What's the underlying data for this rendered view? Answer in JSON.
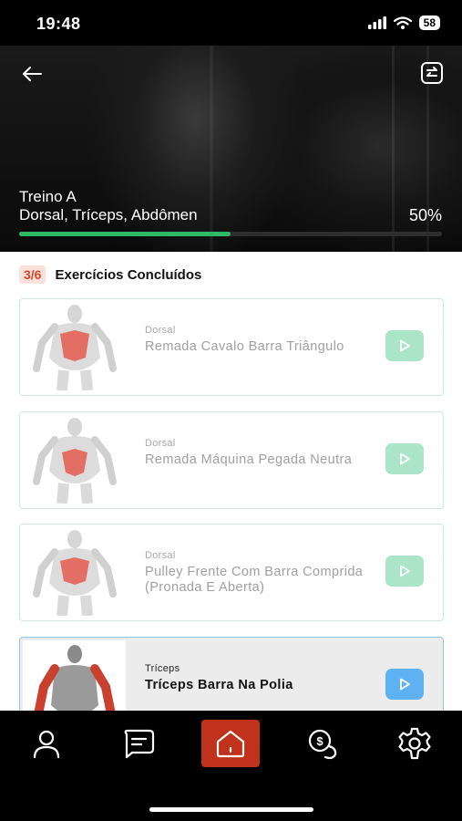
{
  "status": {
    "time": "19:48",
    "battery": "58"
  },
  "workout": {
    "title": "Treino A",
    "muscles": "Dorsal, Tríceps, Abdômen",
    "progress_label": "50%",
    "progress": 0.5
  },
  "summary": {
    "count": "3/6",
    "label": "Exercícios Concluídos"
  },
  "exercises": [
    {
      "category": "Dorsal",
      "name": "Remada Cavalo Barra Triângulo",
      "done": true
    },
    {
      "category": "Dorsal",
      "name": "Remada Máquina Pegada Neutra",
      "done": true
    },
    {
      "category": "Dorsal",
      "name": "Pulley Frente Com Barra Comprida (Pronada E Aberta)",
      "done": true
    },
    {
      "category": "Tríceps",
      "name": "Tríceps Barra Na Polia",
      "done": false
    }
  ],
  "nav": [
    {
      "icon": "profile-icon"
    },
    {
      "icon": "chat-icon"
    },
    {
      "icon": "home-icon",
      "active": true
    },
    {
      "icon": "payments-icon"
    },
    {
      "icon": "settings-icon"
    }
  ],
  "colors": {
    "accent_red": "#c0321b",
    "progress_green": "#2fb865",
    "play_done": "#a9e5c6",
    "play_active": "#5eb1f2",
    "badge_bg": "#fde0da",
    "badge_text": "#d2472f"
  }
}
